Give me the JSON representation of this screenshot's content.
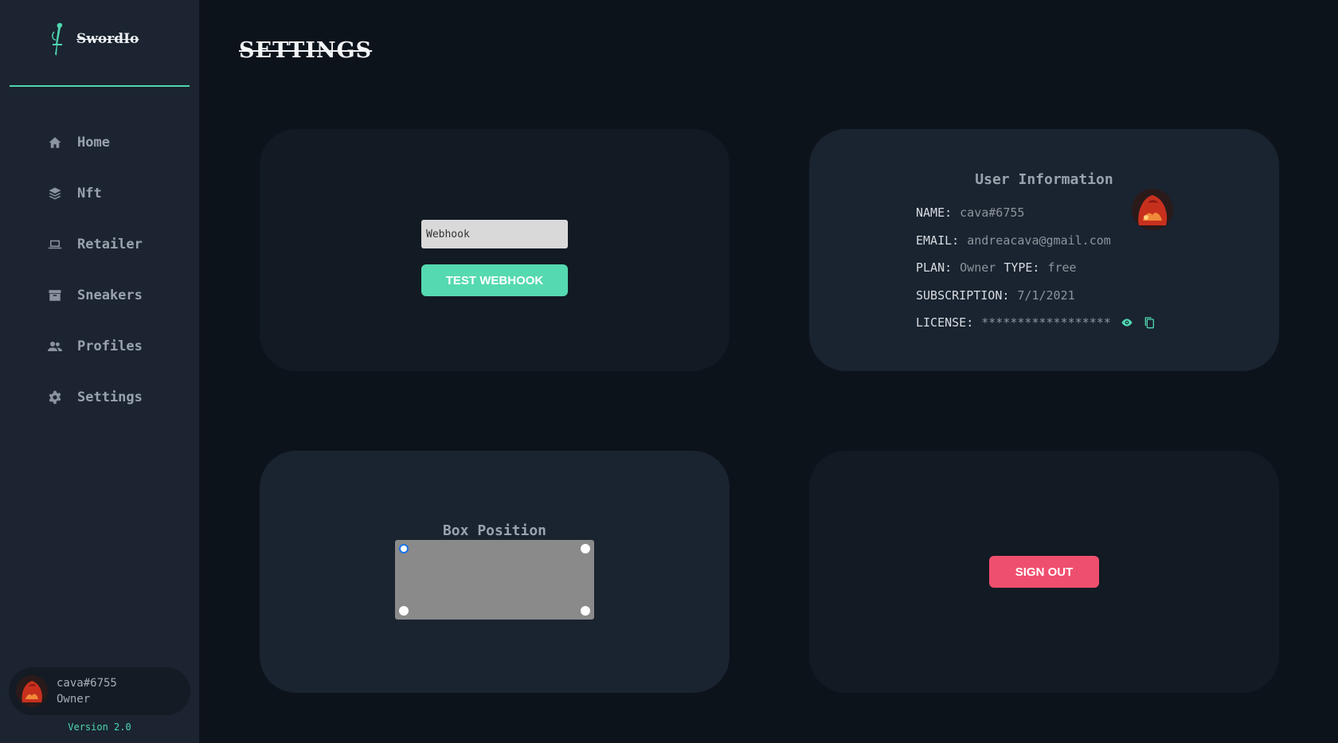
{
  "brand": {
    "name": "SwordIo"
  },
  "page": {
    "title": "SETTINGS"
  },
  "nav": {
    "items": [
      {
        "label": "Home",
        "icon": "home-icon"
      },
      {
        "label": "Nft",
        "icon": "layers-icon"
      },
      {
        "label": "Retailer",
        "icon": "laptop-icon"
      },
      {
        "label": "Sneakers",
        "icon": "archive-box-icon"
      },
      {
        "label": "Profiles",
        "icon": "users-icon"
      },
      {
        "label": "Settings",
        "icon": "gear-icon"
      }
    ]
  },
  "sidebar_user": {
    "name": "cava#6755",
    "role": "Owner"
  },
  "version": "Version 2.0",
  "webhook": {
    "placeholder": "Webhook",
    "button_label": "TEST WEBHOOK"
  },
  "user_info": {
    "title": "User Information",
    "name_label": "NAME:",
    "name_value": "cava#6755",
    "email_label": "EMAIL:",
    "email_value": "andreacava@gmail.com",
    "plan_label": "PLAN:",
    "plan_value": "Owner",
    "type_label": "TYPE:",
    "type_value": "free",
    "subscription_label": "SUBSCRIPTION:",
    "subscription_value": "7/1/2021",
    "license_label": "LICENSE:",
    "license_value": "******************"
  },
  "box_position": {
    "title": "Box Position",
    "options": [
      "top-left",
      "top-right",
      "bottom-left",
      "bottom-right"
    ],
    "selected": "top-left"
  },
  "signout": {
    "button_label": "SIGN OUT"
  },
  "colors": {
    "accent": "#55d9b0",
    "danger": "#ef4f6e",
    "sidebar_bg": "#1b2430",
    "page_bg": "#0d131b"
  }
}
